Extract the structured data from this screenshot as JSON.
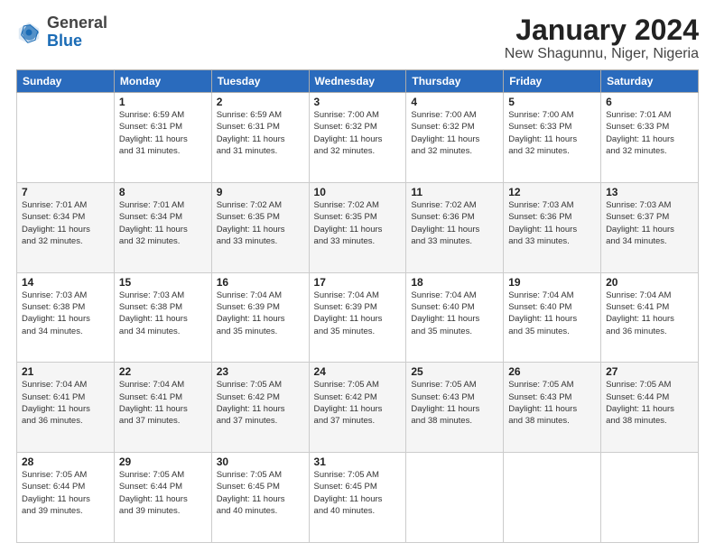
{
  "header": {
    "logo_general": "General",
    "logo_blue": "Blue",
    "month_title": "January 2024",
    "location": "New Shagunnu, Niger, Nigeria"
  },
  "weekdays": [
    "Sunday",
    "Monday",
    "Tuesday",
    "Wednesday",
    "Thursday",
    "Friday",
    "Saturday"
  ],
  "weeks": [
    [
      {
        "day": "",
        "info": ""
      },
      {
        "day": "1",
        "info": "Sunrise: 6:59 AM\nSunset: 6:31 PM\nDaylight: 11 hours\nand 31 minutes."
      },
      {
        "day": "2",
        "info": "Sunrise: 6:59 AM\nSunset: 6:31 PM\nDaylight: 11 hours\nand 31 minutes."
      },
      {
        "day": "3",
        "info": "Sunrise: 7:00 AM\nSunset: 6:32 PM\nDaylight: 11 hours\nand 32 minutes."
      },
      {
        "day": "4",
        "info": "Sunrise: 7:00 AM\nSunset: 6:32 PM\nDaylight: 11 hours\nand 32 minutes."
      },
      {
        "day": "5",
        "info": "Sunrise: 7:00 AM\nSunset: 6:33 PM\nDaylight: 11 hours\nand 32 minutes."
      },
      {
        "day": "6",
        "info": "Sunrise: 7:01 AM\nSunset: 6:33 PM\nDaylight: 11 hours\nand 32 minutes."
      }
    ],
    [
      {
        "day": "7",
        "info": "Sunrise: 7:01 AM\nSunset: 6:34 PM\nDaylight: 11 hours\nand 32 minutes."
      },
      {
        "day": "8",
        "info": "Sunrise: 7:01 AM\nSunset: 6:34 PM\nDaylight: 11 hours\nand 32 minutes."
      },
      {
        "day": "9",
        "info": "Sunrise: 7:02 AM\nSunset: 6:35 PM\nDaylight: 11 hours\nand 33 minutes."
      },
      {
        "day": "10",
        "info": "Sunrise: 7:02 AM\nSunset: 6:35 PM\nDaylight: 11 hours\nand 33 minutes."
      },
      {
        "day": "11",
        "info": "Sunrise: 7:02 AM\nSunset: 6:36 PM\nDaylight: 11 hours\nand 33 minutes."
      },
      {
        "day": "12",
        "info": "Sunrise: 7:03 AM\nSunset: 6:36 PM\nDaylight: 11 hours\nand 33 minutes."
      },
      {
        "day": "13",
        "info": "Sunrise: 7:03 AM\nSunset: 6:37 PM\nDaylight: 11 hours\nand 34 minutes."
      }
    ],
    [
      {
        "day": "14",
        "info": "Sunrise: 7:03 AM\nSunset: 6:38 PM\nDaylight: 11 hours\nand 34 minutes."
      },
      {
        "day": "15",
        "info": "Sunrise: 7:03 AM\nSunset: 6:38 PM\nDaylight: 11 hours\nand 34 minutes."
      },
      {
        "day": "16",
        "info": "Sunrise: 7:04 AM\nSunset: 6:39 PM\nDaylight: 11 hours\nand 35 minutes."
      },
      {
        "day": "17",
        "info": "Sunrise: 7:04 AM\nSunset: 6:39 PM\nDaylight: 11 hours\nand 35 minutes."
      },
      {
        "day": "18",
        "info": "Sunrise: 7:04 AM\nSunset: 6:40 PM\nDaylight: 11 hours\nand 35 minutes."
      },
      {
        "day": "19",
        "info": "Sunrise: 7:04 AM\nSunset: 6:40 PM\nDaylight: 11 hours\nand 35 minutes."
      },
      {
        "day": "20",
        "info": "Sunrise: 7:04 AM\nSunset: 6:41 PM\nDaylight: 11 hours\nand 36 minutes."
      }
    ],
    [
      {
        "day": "21",
        "info": "Sunrise: 7:04 AM\nSunset: 6:41 PM\nDaylight: 11 hours\nand 36 minutes."
      },
      {
        "day": "22",
        "info": "Sunrise: 7:04 AM\nSunset: 6:41 PM\nDaylight: 11 hours\nand 37 minutes."
      },
      {
        "day": "23",
        "info": "Sunrise: 7:05 AM\nSunset: 6:42 PM\nDaylight: 11 hours\nand 37 minutes."
      },
      {
        "day": "24",
        "info": "Sunrise: 7:05 AM\nSunset: 6:42 PM\nDaylight: 11 hours\nand 37 minutes."
      },
      {
        "day": "25",
        "info": "Sunrise: 7:05 AM\nSunset: 6:43 PM\nDaylight: 11 hours\nand 38 minutes."
      },
      {
        "day": "26",
        "info": "Sunrise: 7:05 AM\nSunset: 6:43 PM\nDaylight: 11 hours\nand 38 minutes."
      },
      {
        "day": "27",
        "info": "Sunrise: 7:05 AM\nSunset: 6:44 PM\nDaylight: 11 hours\nand 38 minutes."
      }
    ],
    [
      {
        "day": "28",
        "info": "Sunrise: 7:05 AM\nSunset: 6:44 PM\nDaylight: 11 hours\nand 39 minutes."
      },
      {
        "day": "29",
        "info": "Sunrise: 7:05 AM\nSunset: 6:44 PM\nDaylight: 11 hours\nand 39 minutes."
      },
      {
        "day": "30",
        "info": "Sunrise: 7:05 AM\nSunset: 6:45 PM\nDaylight: 11 hours\nand 40 minutes."
      },
      {
        "day": "31",
        "info": "Sunrise: 7:05 AM\nSunset: 6:45 PM\nDaylight: 11 hours\nand 40 minutes."
      },
      {
        "day": "",
        "info": ""
      },
      {
        "day": "",
        "info": ""
      },
      {
        "day": "",
        "info": ""
      }
    ]
  ]
}
